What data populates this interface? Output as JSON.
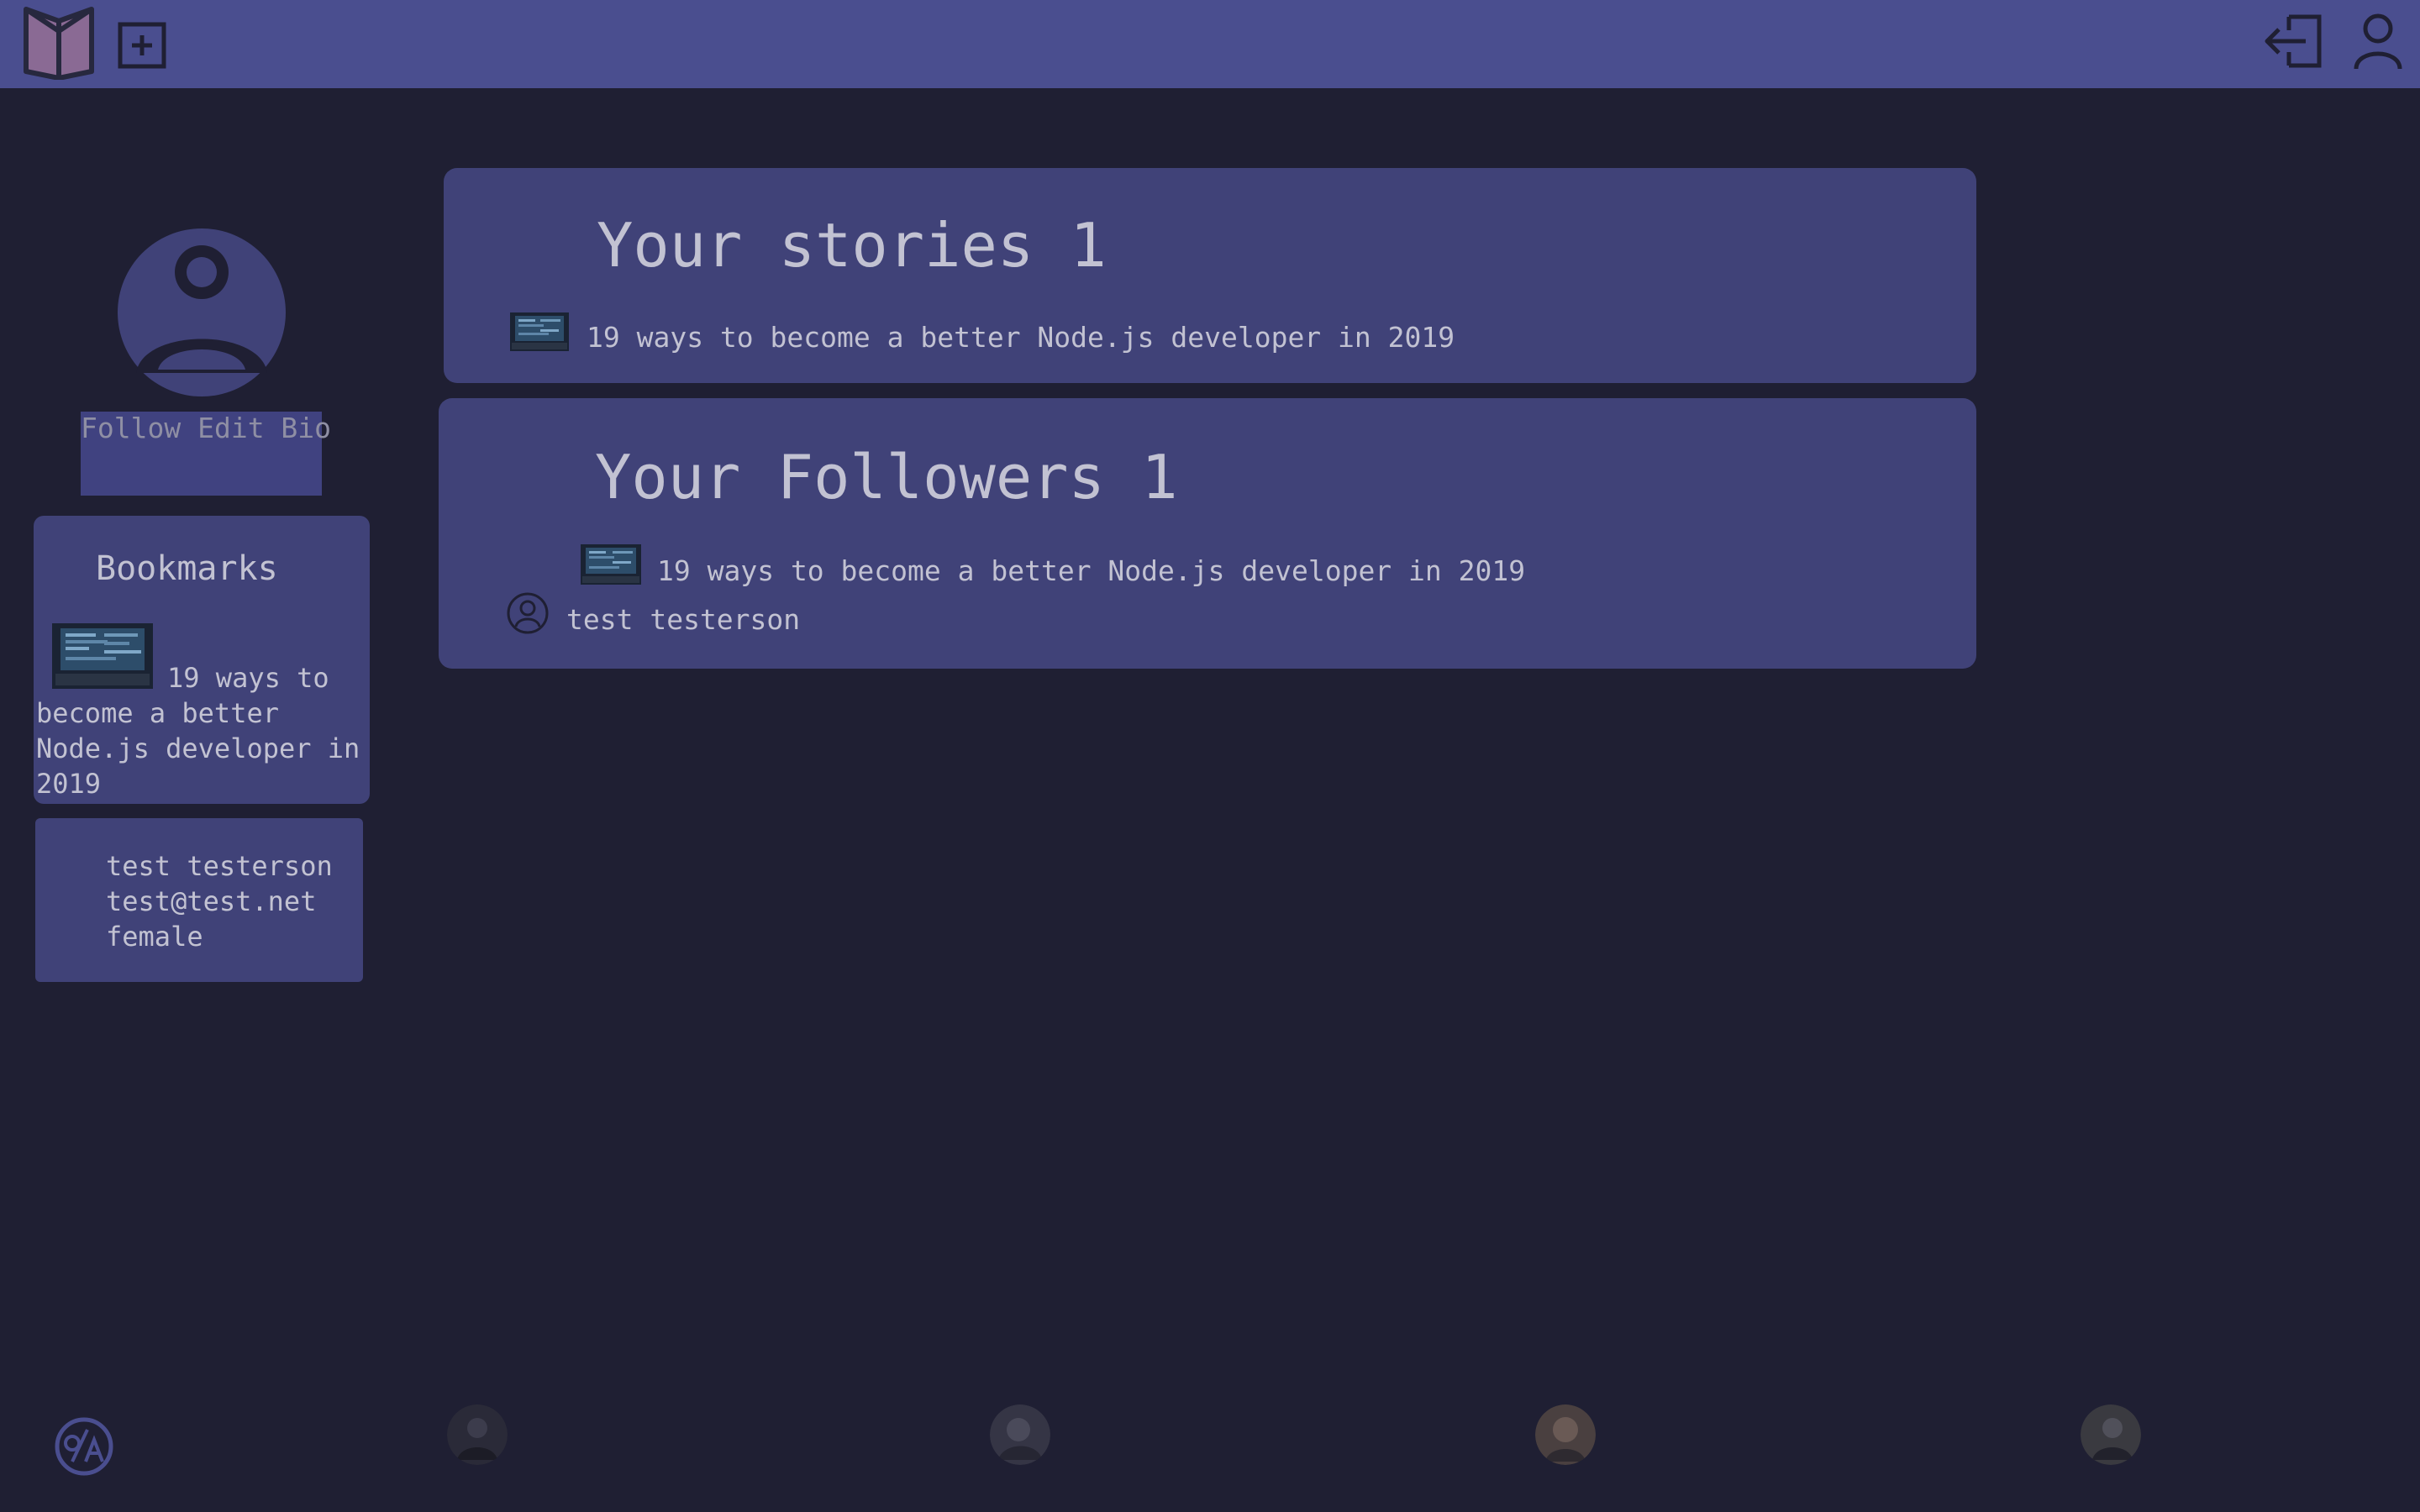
{
  "topbar": {
    "logo_icon": "book-logo-icon",
    "add_icon": "add-story-icon",
    "logout_icon": "logout-icon",
    "user_icon": "user-icon"
  },
  "profile": {
    "avatar_icon": "user-circle-icon",
    "follow_label": "Follow",
    "edit_bio_label": "Edit Bio"
  },
  "bookmarks": {
    "title": "Bookmarks",
    "items": [
      {
        "text": "19 ways to become a better Node.js developer in 2019",
        "thumb_icon": "laptop-code-thumbnail"
      }
    ]
  },
  "user_info": {
    "name": "test testerson",
    "email": "test@test.net",
    "gender": "female"
  },
  "stories": {
    "heading": "Your stories 1",
    "items": [
      {
        "text": "19 ways to become a better Node.js developer in 2019",
        "thumb_icon": "laptop-code-thumbnail"
      }
    ]
  },
  "followers": {
    "heading": "Your Followers 1",
    "story": "19 ways to become a better Node.js developer in 2019",
    "follower_name": "test testerson"
  },
  "footer": {
    "logo_icon": "a11y-logo-icon",
    "avatars": [
      "team-avatar-1",
      "team-avatar-2",
      "team-avatar-3",
      "team-avatar-4"
    ]
  },
  "colors": {
    "background": "#1f1f33",
    "topbar": "#4a4e8f",
    "card": "#404278",
    "text": "#c2c2d2"
  }
}
